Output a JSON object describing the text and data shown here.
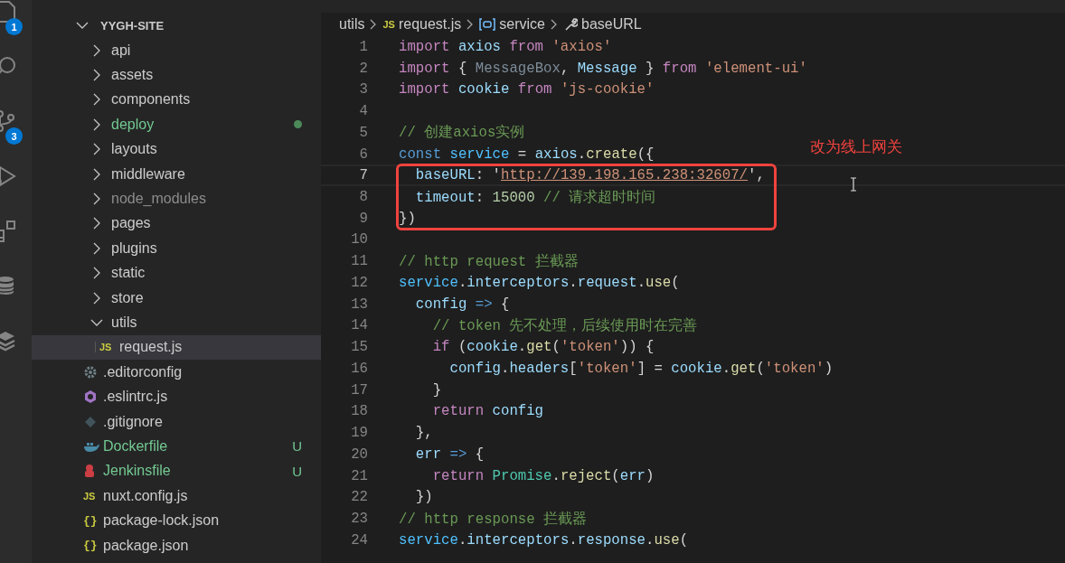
{
  "activity_bar": [
    {
      "kind": "files",
      "badge": "1"
    },
    {
      "kind": "search"
    },
    {
      "kind": "source-control",
      "badge": "3"
    },
    {
      "kind": "run"
    },
    {
      "kind": "extensions"
    },
    {
      "kind": "database"
    },
    {
      "kind": "layers"
    }
  ],
  "explorer": {
    "root": "YYGH-SITE",
    "expanded": true,
    "items": [
      {
        "name": "api",
        "kind": "folder",
        "expanded": false,
        "color": "#cccccc",
        "dot": false,
        "selected": false
      },
      {
        "name": "assets",
        "kind": "folder",
        "expanded": false,
        "color": "#cccccc",
        "dot": false,
        "selected": false
      },
      {
        "name": "components",
        "kind": "folder",
        "expanded": false,
        "color": "#cccccc",
        "dot": false,
        "selected": false
      },
      {
        "name": "deploy",
        "kind": "folder",
        "expanded": false,
        "color": "#73c991",
        "dot": true,
        "selected": false
      },
      {
        "name": "layouts",
        "kind": "folder",
        "expanded": false,
        "color": "#cccccc",
        "dot": false,
        "selected": false
      },
      {
        "name": "middleware",
        "kind": "folder",
        "expanded": false,
        "color": "#cccccc",
        "dot": false,
        "selected": false
      },
      {
        "name": "node_modules",
        "kind": "folder",
        "expanded": false,
        "color": "#8c8c8c",
        "dot": false,
        "selected": false
      },
      {
        "name": "pages",
        "kind": "folder",
        "expanded": false,
        "color": "#cccccc",
        "dot": false,
        "selected": false
      },
      {
        "name": "plugins",
        "kind": "folder",
        "expanded": false,
        "color": "#cccccc",
        "dot": false,
        "selected": false
      },
      {
        "name": "static",
        "kind": "folder",
        "expanded": false,
        "color": "#cccccc",
        "dot": false,
        "selected": false
      },
      {
        "name": "store",
        "kind": "folder",
        "expanded": false,
        "color": "#cccccc",
        "dot": false,
        "selected": false
      },
      {
        "name": "utils",
        "kind": "folder",
        "expanded": true,
        "color": "#cccccc",
        "dot": false,
        "selected": false,
        "children": [
          {
            "name": "request.js",
            "kind": "js",
            "icon_text": "JS",
            "color": "#cccccc",
            "dot": false,
            "selected": true
          }
        ]
      },
      {
        "name": ".editorconfig",
        "kind": "config",
        "color": "#cccccc",
        "dot": false,
        "selected": false
      },
      {
        "name": ".eslintrc.js",
        "kind": "eslint",
        "color": "#cccccc",
        "dot": false,
        "selected": false
      },
      {
        "name": ".gitignore",
        "kind": "git",
        "color": "#cccccc",
        "dot": false,
        "selected": false
      },
      {
        "name": "Dockerfile",
        "kind": "docker",
        "color": "#73c991",
        "dot": false,
        "badge": "U",
        "selected": false
      },
      {
        "name": "Jenkinsfile",
        "kind": "jenkins",
        "color": "#73c991",
        "dot": false,
        "badge": "U",
        "selected": false
      },
      {
        "name": "nuxt.config.js",
        "kind": "js",
        "icon_text": "JS",
        "color": "#cccccc",
        "dot": false,
        "selected": false
      },
      {
        "name": "package-lock.json",
        "kind": "json",
        "icon_text": "{}",
        "color": "#cccccc",
        "dot": false,
        "selected": false
      },
      {
        "name": "package.json",
        "kind": "json",
        "icon_text": "{}",
        "color": "#cccccc",
        "dot": false,
        "selected": false
      }
    ]
  },
  "breadcrumb": [
    {
      "text": "utils",
      "kind": "folder"
    },
    {
      "text": "request.js",
      "kind": "js",
      "icon_text": "JS"
    },
    {
      "text": "service",
      "kind": "variable"
    },
    {
      "text": "baseURL",
      "kind": "property"
    }
  ],
  "code_lines": [
    {
      "number": "1",
      "current": false,
      "boxed": false,
      "tokens": [
        {
          "t": "import",
          "kind": "kw"
        },
        {
          "t": " axios",
          "kind": "var"
        },
        {
          "t": " from",
          "kind": "kw"
        },
        {
          "t": " 'axios'",
          "kind": "str"
        }
      ]
    },
    {
      "number": "2",
      "current": false,
      "boxed": false,
      "tokens": [
        {
          "t": "import",
          "kind": "kw"
        },
        {
          "t": " { ",
          "kind": "plain"
        },
        {
          "t": "MessageBox",
          "kind": "unused"
        },
        {
          "t": ", ",
          "kind": "plain"
        },
        {
          "t": "Message",
          "kind": "var"
        },
        {
          "t": " } ",
          "kind": "plain"
        },
        {
          "t": "from",
          "kind": "kw"
        },
        {
          "t": " 'element-ui'",
          "kind": "str"
        }
      ]
    },
    {
      "number": "3",
      "current": false,
      "boxed": false,
      "tokens": [
        {
          "t": "import",
          "kind": "kw"
        },
        {
          "t": " cookie",
          "kind": "var"
        },
        {
          "t": " from",
          "kind": "kw"
        },
        {
          "t": " 'js-cookie'",
          "kind": "str"
        }
      ]
    },
    {
      "number": "4",
      "current": false
    },
    {
      "number": "5",
      "current": false,
      "boxed": false,
      "tokens": [
        {
          "t": "// 创建axios实例",
          "kind": "comment"
        }
      ]
    },
    {
      "number": "6",
      "current": false,
      "boxed": false,
      "tokens": [
        {
          "t": "const",
          "kind": "storage"
        },
        {
          "t": " service",
          "kind": "const"
        },
        {
          "t": " = ",
          "kind": "plain"
        },
        {
          "t": "axios",
          "kind": "var"
        },
        {
          "t": ".",
          "kind": "plain"
        },
        {
          "t": "create",
          "kind": "func"
        },
        {
          "t": "({",
          "kind": "plain"
        }
      ]
    },
    {
      "number": "7",
      "current": true,
      "boxed": true,
      "tokens": [
        {
          "t": "  baseURL",
          "kind": "var"
        },
        {
          "t": ": '",
          "kind": "plain"
        },
        {
          "t": "http://139.198.165.238:32607/",
          "kind": "url"
        },
        {
          "t": "',",
          "kind": "plain"
        }
      ]
    },
    {
      "number": "8",
      "current": false,
      "boxed": true,
      "tokens": [
        {
          "t": "  timeout",
          "kind": "var"
        },
        {
          "t": ": ",
          "kind": "plain"
        },
        {
          "t": "15000",
          "kind": "num"
        },
        {
          "t": " // 请求超时时间",
          "kind": "comment"
        }
      ]
    },
    {
      "number": "9",
      "current": false,
      "boxed": true,
      "tokens": [
        {
          "t": "})",
          "kind": "plain"
        }
      ]
    },
    {
      "number": "10",
      "current": false
    },
    {
      "number": "11",
      "current": false,
      "boxed": false,
      "tokens": [
        {
          "t": "// http request 拦截器",
          "kind": "comment"
        }
      ]
    },
    {
      "number": "12",
      "current": false,
      "boxed": false,
      "tokens": [
        {
          "t": "service",
          "kind": "const"
        },
        {
          "t": ".",
          "kind": "plain"
        },
        {
          "t": "interceptors",
          "kind": "var"
        },
        {
          "t": ".",
          "kind": "plain"
        },
        {
          "t": "request",
          "kind": "var"
        },
        {
          "t": ".",
          "kind": "plain"
        },
        {
          "t": "use",
          "kind": "func"
        },
        {
          "t": "(",
          "kind": "plain"
        }
      ]
    },
    {
      "number": "13",
      "current": false,
      "boxed": false,
      "tokens": [
        {
          "t": "  config",
          "kind": "var"
        },
        {
          "t": " => ",
          "kind": "storage"
        },
        {
          "t": "{",
          "kind": "plain"
        }
      ]
    },
    {
      "number": "14",
      "current": false,
      "boxed": false,
      "tokens": [
        {
          "t": "    // token 先不处理，后续使用时在完善",
          "kind": "comment"
        }
      ]
    },
    {
      "number": "15",
      "current": false,
      "boxed": false,
      "tokens": [
        {
          "t": "    if",
          "kind": "kw"
        },
        {
          "t": " (",
          "kind": "plain"
        },
        {
          "t": "cookie",
          "kind": "var"
        },
        {
          "t": ".",
          "kind": "plain"
        },
        {
          "t": "get",
          "kind": "func"
        },
        {
          "t": "(",
          "kind": "plain"
        },
        {
          "t": "'token'",
          "kind": "str"
        },
        {
          "t": ")) {",
          "kind": "plain"
        }
      ]
    },
    {
      "number": "16",
      "current": false,
      "boxed": false,
      "tokens": [
        {
          "t": "      config",
          "kind": "var"
        },
        {
          "t": ".",
          "kind": "plain"
        },
        {
          "t": "headers",
          "kind": "var"
        },
        {
          "t": "[",
          "kind": "plain"
        },
        {
          "t": "'token'",
          "kind": "str"
        },
        {
          "t": "] = ",
          "kind": "plain"
        },
        {
          "t": "cookie",
          "kind": "var"
        },
        {
          "t": ".",
          "kind": "plain"
        },
        {
          "t": "get",
          "kind": "func"
        },
        {
          "t": "(",
          "kind": "plain"
        },
        {
          "t": "'token'",
          "kind": "str"
        },
        {
          "t": ")",
          "kind": "plain"
        }
      ]
    },
    {
      "number": "17",
      "current": false,
      "boxed": false,
      "tokens": [
        {
          "t": "    }",
          "kind": "plain"
        }
      ]
    },
    {
      "number": "18",
      "current": false,
      "boxed": false,
      "tokens": [
        {
          "t": "    return",
          "kind": "kw"
        },
        {
          "t": " config",
          "kind": "var"
        }
      ]
    },
    {
      "number": "19",
      "current": false,
      "boxed": false,
      "tokens": [
        {
          "t": "  },",
          "kind": "plain"
        }
      ]
    },
    {
      "number": "20",
      "current": false,
      "boxed": false,
      "tokens": [
        {
          "t": "  err",
          "kind": "var"
        },
        {
          "t": " => ",
          "kind": "storage"
        },
        {
          "t": "{",
          "kind": "plain"
        }
      ]
    },
    {
      "number": "21",
      "current": false,
      "boxed": false,
      "tokens": [
        {
          "t": "    return",
          "kind": "kw"
        },
        {
          "t": " Promise",
          "kind": "class"
        },
        {
          "t": ".",
          "kind": "plain"
        },
        {
          "t": "reject",
          "kind": "func"
        },
        {
          "t": "(",
          "kind": "plain"
        },
        {
          "t": "err",
          "kind": "var"
        },
        {
          "t": ")",
          "kind": "plain"
        }
      ]
    },
    {
      "number": "22",
      "current": false,
      "boxed": false,
      "tokens": [
        {
          "t": "  })",
          "kind": "plain"
        }
      ]
    },
    {
      "number": "23",
      "current": false,
      "boxed": false,
      "tokens": [
        {
          "t": "// http response 拦截器",
          "kind": "comment"
        }
      ]
    },
    {
      "number": "24",
      "current": false,
      "boxed": false,
      "tokens": [
        {
          "t": "service",
          "kind": "const"
        },
        {
          "t": ".",
          "kind": "plain"
        },
        {
          "t": "interceptors",
          "kind": "var"
        },
        {
          "t": ".",
          "kind": "plain"
        },
        {
          "t": "response",
          "kind": "var"
        },
        {
          "t": ".",
          "kind": "plain"
        },
        {
          "t": "use",
          "kind": "func"
        },
        {
          "t": "(",
          "kind": "plain"
        }
      ]
    }
  ],
  "annotation": {
    "text": "改为线上网关"
  }
}
